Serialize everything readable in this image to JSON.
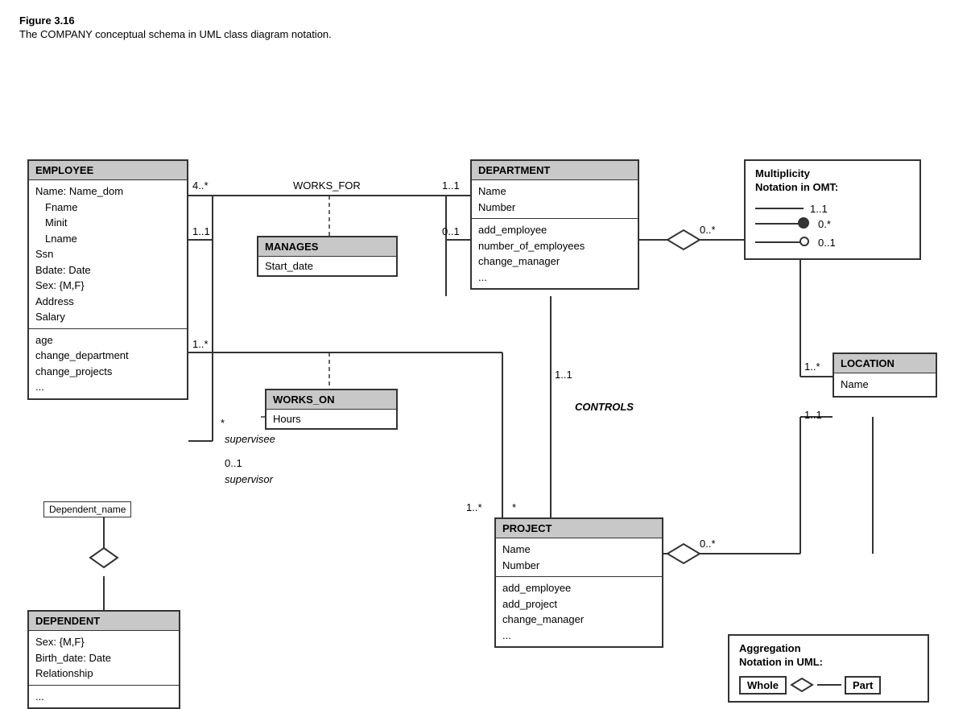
{
  "figure": {
    "title": "Figure 3.16",
    "caption": "The COMPANY conceptual schema in UML class diagram notation."
  },
  "classes": {
    "employee": {
      "header": "EMPLOYEE",
      "section1": [
        "Name: Name_dom",
        "    Fname",
        "    Minit",
        "    Lname",
        "Ssn",
        "Bdate: Date",
        "Sex: {M,F}",
        "Address",
        "Salary"
      ],
      "section2": [
        "age",
        "change_department",
        "change_projects",
        "..."
      ]
    },
    "department": {
      "header": "DEPARTMENT",
      "section1": [
        "Name",
        "Number"
      ],
      "section2": [
        "add_employee",
        "number_of_employees",
        "change_manager",
        "..."
      ]
    },
    "project": {
      "header": "PROJECT",
      "section1": [
        "Name",
        "Number"
      ],
      "section2": [
        "add_employee",
        "add_project",
        "change_manager",
        "..."
      ]
    },
    "location": {
      "header": "LOCATION",
      "section1": [
        "Name"
      ]
    },
    "dependent": {
      "header": "DEPENDENT",
      "section1": [
        "Sex: {M,F}",
        "Birth_date: Date",
        "Relationship"
      ],
      "section2": [
        "..."
      ]
    }
  },
  "assoc_classes": {
    "manages": {
      "header": "MANAGES",
      "section": [
        "Start_date"
      ]
    },
    "works_on": {
      "header": "WORKS_ON",
      "section": [
        "Hours"
      ]
    }
  },
  "labels": {
    "works_for": "WORKS_FOR",
    "controls": "CONTROLS",
    "supervisee": "supervisee",
    "supervisor": "supervisor",
    "dep_name": "Dependent_name",
    "mult_11a": "4..*",
    "mult_11b": "1..1",
    "mult_11c": "1..1",
    "mult_01": "0..1",
    "mult_1star": "1..*",
    "mult_star1": "*",
    "mult_0star1": "0..*",
    "mult_1star2": "1..*",
    "mult_star2": "*",
    "mult_0star2": "0..*",
    "mult_11d": "1..1",
    "mult_01b": "0..1"
  },
  "notation": {
    "title1": "Multiplicity",
    "title2": "Notation in OMT:",
    "rows": [
      {
        "label": "1..1"
      },
      {
        "label": "0.*"
      },
      {
        "label": "0..1"
      }
    ]
  },
  "aggregation": {
    "title1": "Aggregation",
    "title2": "Notation in UML:",
    "whole_label": "Whole",
    "part_label": "Part"
  }
}
